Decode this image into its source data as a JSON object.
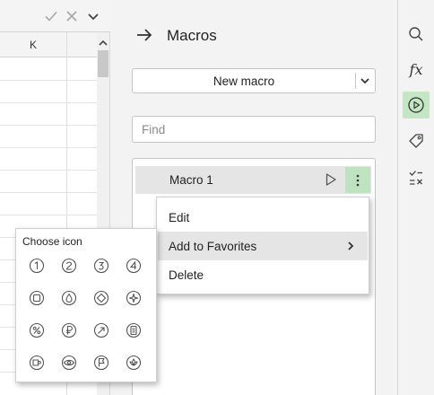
{
  "sheet": {
    "column_headers": [
      "K"
    ]
  },
  "panel": {
    "title": "Macros",
    "new_macro_label": "New macro",
    "find_placeholder": "Find",
    "macros": [
      {
        "name": "Macro 1"
      }
    ]
  },
  "context_menu": {
    "items": [
      {
        "label": "Edit"
      },
      {
        "label": "Add to Favorites"
      },
      {
        "label": "Delete"
      }
    ]
  },
  "icon_picker": {
    "title": "Choose icon",
    "icons": [
      "circled-digit-one-icon",
      "circled-digit-two-icon",
      "circled-digit-three-icon",
      "circled-digit-four-icon",
      "circled-square-icon",
      "circled-drop-icon",
      "circled-diamond-icon",
      "circled-star-icon",
      "circled-percent-icon",
      "circled-ruble-icon",
      "circled-arrow-up-right-icon",
      "circled-document-icon",
      "circled-cup-icon",
      "circled-eye-icon",
      "circled-flag-icon",
      "circled-lotus-icon"
    ]
  },
  "rail": {
    "buttons": [
      "search-icon",
      "function-icon",
      "macro-play-icon",
      "tag-icon",
      "spellcheck-icon"
    ],
    "active": "macro-play-icon"
  },
  "colors": {
    "accent_active": "#c4e6c5",
    "selection_gray": "#e5e5e5",
    "panel_bg": "#f3f3f3"
  }
}
